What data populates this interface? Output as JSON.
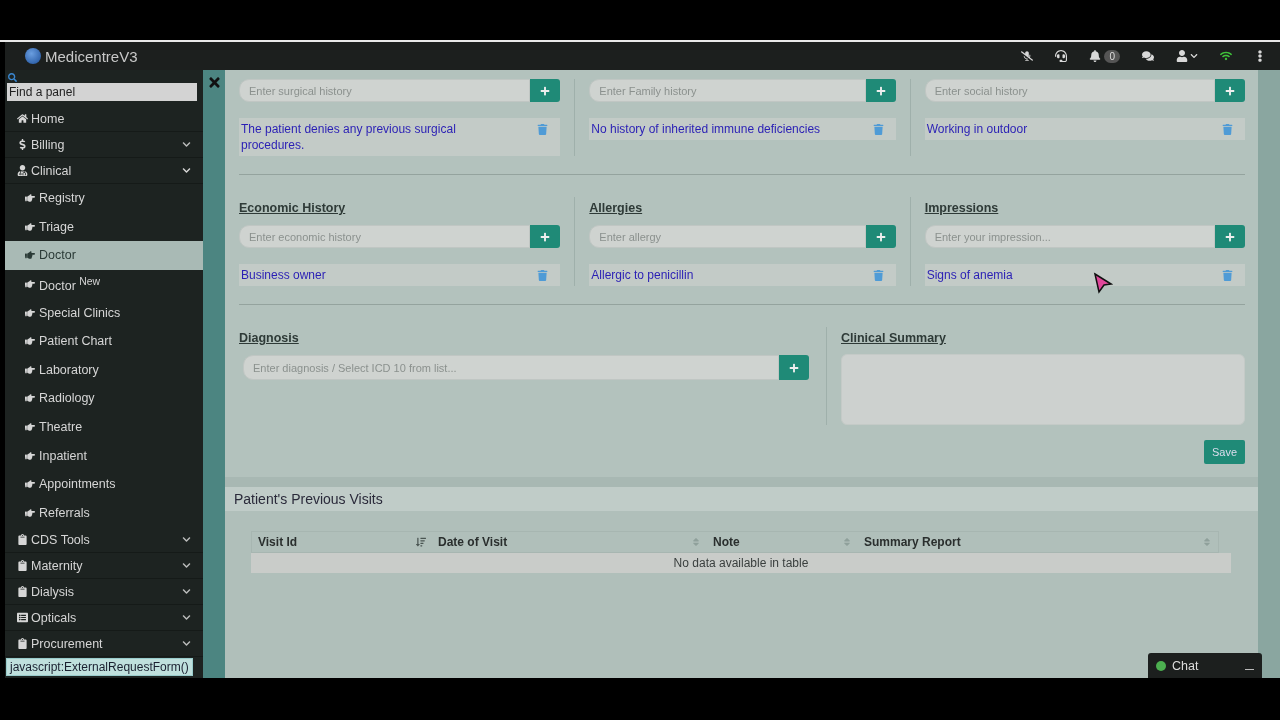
{
  "topbar": {
    "title": "MedicentreV3",
    "notification_count": "0"
  },
  "sidebar": {
    "search_placeholder": "Find a panel",
    "items": [
      {
        "label": "Home",
        "kind": "link",
        "selected": false
      },
      {
        "label": "Billing",
        "kind": "group",
        "expanded": false,
        "selected": false
      },
      {
        "label": "Clinical",
        "kind": "group",
        "expanded": true,
        "selected": false,
        "children": [
          {
            "label": "Registry",
            "selected": false
          },
          {
            "label": "Triage",
            "selected": false
          },
          {
            "label": "Doctor",
            "selected": true
          },
          {
            "label": "Doctor $^{New}$",
            "selected": false
          },
          {
            "label": "Special Clinics",
            "selected": false
          },
          {
            "label": "Patient Chart",
            "selected": false
          },
          {
            "label": "Laboratory",
            "selected": false
          },
          {
            "label": "Radiology",
            "selected": false
          },
          {
            "label": "Theatre",
            "selected": false
          },
          {
            "label": "Inpatient",
            "selected": false
          },
          {
            "label": "Appointments",
            "selected": false
          },
          {
            "label": "Referrals",
            "selected": false
          }
        ]
      },
      {
        "label": "CDS Tools",
        "kind": "group",
        "expanded": false,
        "selected": false
      },
      {
        "label": "Maternity",
        "kind": "group",
        "expanded": false,
        "selected": false
      },
      {
        "label": "Dialysis",
        "kind": "group",
        "expanded": false,
        "selected": false
      },
      {
        "label": "Opticals",
        "kind": "group",
        "expanded": false,
        "selected": false
      },
      {
        "label": "Procurement",
        "kind": "group",
        "expanded": false,
        "selected": false
      }
    ]
  },
  "history_rows": [
    [
      {
        "placeholder": "Enter surgical history",
        "entries": [
          "The patient denies any previous surgical procedures."
        ]
      },
      {
        "placeholder": "Enter Family history",
        "entries": [
          "No history of inherited immune deficiencies"
        ]
      },
      {
        "placeholder": "Enter social history",
        "entries": [
          "Working in outdoor"
        ]
      }
    ],
    [
      {
        "title": "Economic History",
        "placeholder": "Enter economic history",
        "entries": [
          "Business owner"
        ]
      },
      {
        "title": "Allergies",
        "placeholder": "Enter allergy",
        "entries": [
          "Allergic to penicillin"
        ]
      },
      {
        "title": "Impressions",
        "placeholder": "Enter your impression...",
        "entries": [
          "Signs of anemia"
        ]
      }
    ]
  ],
  "diagnosis": {
    "title": "Diagnosis",
    "placeholder": "Enter diagnosis / Select ICD 10 from list..."
  },
  "clinical_summary": {
    "title": "Clinical Summary"
  },
  "save_button": "Save",
  "previous_visits": {
    "title": "Patient's Previous Visits",
    "columns": [
      {
        "label": "Visit Id",
        "sorted": true
      },
      {
        "label": "Date of Visit",
        "sorted": false
      },
      {
        "label": "Note",
        "sorted": false
      },
      {
        "label": "Summary Report",
        "sorted": false
      }
    ],
    "empty_text": "No data available in table"
  },
  "status_link": "javascript:ExternalRequestForm()",
  "chat": {
    "label": "Chat",
    "online": true
  }
}
